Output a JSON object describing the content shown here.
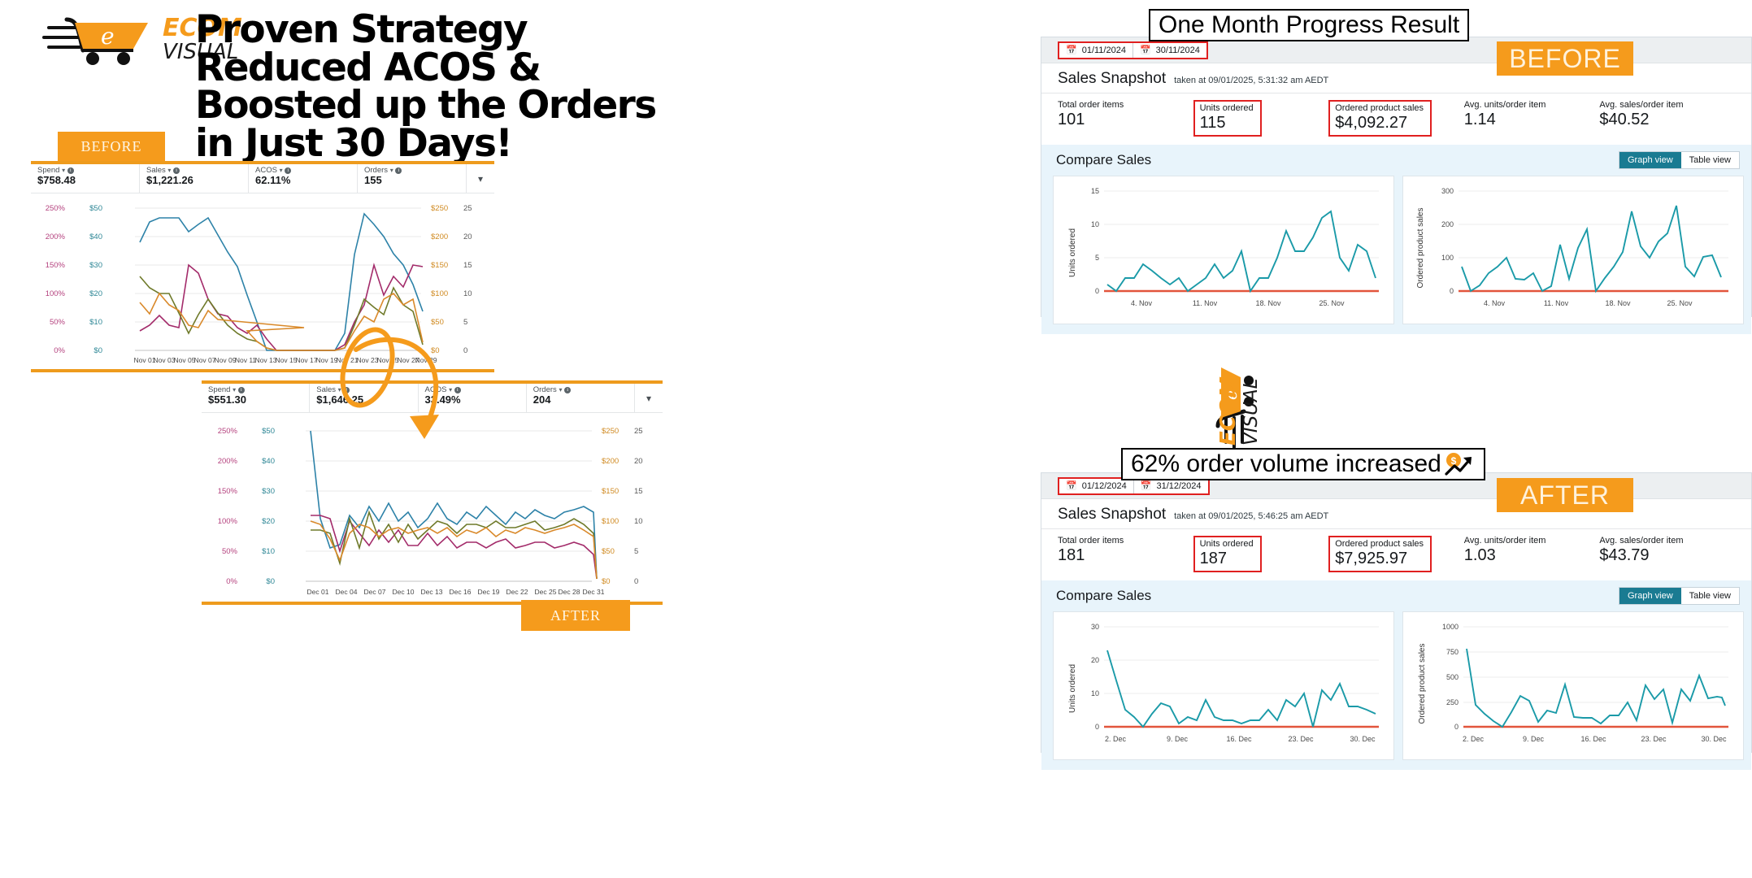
{
  "brand": {
    "ecom": "ECOM",
    "visual": "VISUAL"
  },
  "headline": "Proven Strategy Reduced ACOS & Boosted up the Orders in Just 30 Days!",
  "tabs": {
    "before": "BEFORE",
    "after": "AFTER"
  },
  "callouts": {
    "title1": "One Month Progress Result",
    "title2": "62% order volume increased",
    "badge_before": "BEFORE",
    "badge_after": "AFTER"
  },
  "colors": {
    "accent_orange": "#F59B1C",
    "highlight_red": "#e02020",
    "teal_line": "#1a9aa8",
    "panel_blue": "#e8f4fb",
    "toggle_active": "#1a7b92"
  },
  "ads_before": {
    "metrics": [
      {
        "label": "Spend",
        "value": "$758.48"
      },
      {
        "label": "Sales",
        "value": "$1,221.26"
      },
      {
        "label": "ACOS",
        "value": "62.11%"
      },
      {
        "label": "Orders",
        "value": "155"
      }
    ],
    "left_axis_pct": [
      "250%",
      "200%",
      "150%",
      "100%",
      "50%",
      "0%"
    ],
    "left_axis_usd": [
      "$50",
      "$40",
      "$30",
      "$20",
      "$10",
      "$0"
    ],
    "right_axis_usd": [
      "$250",
      "$200",
      "$150",
      "$100",
      "$50",
      "$0"
    ],
    "right_axis_count": [
      "25",
      "20",
      "15",
      "10",
      "5",
      "0"
    ],
    "x_ticks": [
      "Nov 01",
      "Nov 03",
      "Nov 05",
      "Nov 07",
      "Nov 09",
      "Nov 11",
      "Nov 13",
      "Nov 15",
      "Nov 17",
      "Nov 19",
      "Nov 21",
      "Nov 23",
      "Nov 25",
      "Nov 27",
      "Nov 29"
    ]
  },
  "ads_after": {
    "metrics": [
      {
        "label": "Spend",
        "value": "$551.30"
      },
      {
        "label": "Sales",
        "value": "$1,646.25"
      },
      {
        "label": "ACOS",
        "value": "33.49%"
      },
      {
        "label": "Orders",
        "value": "204"
      }
    ],
    "left_axis_pct": [
      "250%",
      "200%",
      "150%",
      "100%",
      "50%",
      "0%"
    ],
    "left_axis_usd": [
      "$50",
      "$40",
      "$30",
      "$20",
      "$10",
      "$0"
    ],
    "right_axis_usd": [
      "$250",
      "$200",
      "$150",
      "$100",
      "$50",
      "$0"
    ],
    "right_axis_count": [
      "25",
      "20",
      "15",
      "10",
      "5",
      "0"
    ],
    "x_ticks": [
      "Dec 01",
      "Dec 04",
      "Dec 07",
      "Dec 10",
      "Dec 13",
      "Dec 16",
      "Dec 19",
      "Dec 22",
      "Dec 25",
      "Dec 28",
      "Dec 31"
    ]
  },
  "snapshot_before": {
    "date_from": "01/11/2024",
    "date_to": "30/11/2024",
    "title": "Sales Snapshot",
    "subtitle": "taken at 09/01/2025, 5:31:32 am AEDT",
    "kpis": [
      {
        "label": "Total order items",
        "value": "101",
        "boxed": false
      },
      {
        "label": "Units ordered",
        "value": "115",
        "boxed": true
      },
      {
        "label": "Ordered product sales",
        "value": "$4,092.27",
        "boxed": true
      },
      {
        "label": "Avg. units/order item",
        "value": "1.14",
        "boxed": false
      },
      {
        "label": "Avg. sales/order item",
        "value": "$40.52",
        "boxed": false
      }
    ],
    "compare_title": "Compare Sales",
    "graph_view": "Graph view",
    "table_view": "Table view"
  },
  "snapshot_after": {
    "date_from": "01/12/2024",
    "date_to": "31/12/2024",
    "title": "Sales Snapshot",
    "subtitle": "taken at 09/01/2025, 5:46:25 am AEDT",
    "kpis": [
      {
        "label": "Total order items",
        "value": "181",
        "boxed": false
      },
      {
        "label": "Units ordered",
        "value": "187",
        "boxed": true
      },
      {
        "label": "Ordered product sales",
        "value": "$7,925.97",
        "boxed": true
      },
      {
        "label": "Avg. units/order item",
        "value": "1.03",
        "boxed": false
      },
      {
        "label": "Avg. sales/order item",
        "value": "$43.79",
        "boxed": false
      }
    ],
    "compare_title": "Compare Sales",
    "graph_view": "Graph view",
    "table_view": "Table view"
  },
  "chart_data": [
    {
      "id": "before_units_ordered",
      "type": "line",
      "title": "",
      "ylabel": "Units ordered",
      "xlabel": "",
      "ylim": [
        0,
        15
      ],
      "yticks": [
        0,
        5,
        10,
        15
      ],
      "xticks": [
        "4. Nov",
        "11. Nov",
        "18. Nov",
        "25. Nov"
      ],
      "x": [
        "1. Nov",
        "2. Nov",
        "3. Nov",
        "4. Nov",
        "5. Nov",
        "6. Nov",
        "7. Nov",
        "8. Nov",
        "9. Nov",
        "10. Nov",
        "11. Nov",
        "12. Nov",
        "13. Nov",
        "14. Nov",
        "15. Nov",
        "16. Nov",
        "17. Nov",
        "18. Nov",
        "19. Nov",
        "20. Nov",
        "21. Nov",
        "22. Nov",
        "23. Nov",
        "24. Nov",
        "25. Nov",
        "26. Nov",
        "27. Nov",
        "28. Nov",
        "29. Nov",
        "30. Nov"
      ],
      "values": [
        1,
        0,
        2,
        2,
        4,
        3,
        2,
        1,
        2,
        0,
        1,
        2,
        4,
        2,
        3,
        6,
        0,
        2,
        2,
        5,
        9,
        6,
        6,
        8,
        11,
        12,
        5,
        3,
        7,
        6,
        2
      ],
      "grid": true,
      "legend": "none"
    },
    {
      "id": "before_ordered_product_sales",
      "type": "line",
      "title": "",
      "ylabel": "Ordered product sales",
      "xlabel": "",
      "ylim": [
        0,
        300
      ],
      "yticks": [
        0,
        100,
        200,
        300
      ],
      "xticks": [
        "4. Nov",
        "11. Nov",
        "18. Nov",
        "25. Nov"
      ],
      "x": [
        "1. Nov",
        "2. Nov",
        "3. Nov",
        "4. Nov",
        "5. Nov",
        "6. Nov",
        "7. Nov",
        "8. Nov",
        "9. Nov",
        "10. Nov",
        "11. Nov",
        "12. Nov",
        "13. Nov",
        "14. Nov",
        "15. Nov",
        "16. Nov",
        "17. Nov",
        "18. Nov",
        "19. Nov",
        "20. Nov",
        "21. Nov",
        "22. Nov",
        "23. Nov",
        "24. Nov",
        "25. Nov",
        "26. Nov",
        "27. Nov",
        "28. Nov",
        "29. Nov",
        "30. Nov"
      ],
      "values": [
        72,
        0,
        18,
        53,
        72,
        100,
        36,
        34,
        54,
        0,
        15,
        140,
        37,
        130,
        185,
        0,
        40,
        72,
        118,
        240,
        133,
        100,
        148,
        172,
        257,
        72,
        43,
        103,
        107,
        42
      ],
      "grid": true,
      "legend": "none"
    },
    {
      "id": "after_units_ordered",
      "type": "line",
      "title": "",
      "ylabel": "Units ordered",
      "xlabel": "",
      "ylim": [
        0,
        30
      ],
      "yticks": [
        0,
        10,
        20,
        30
      ],
      "xticks": [
        "2. Dec",
        "9. Dec",
        "16. Dec",
        "23. Dec",
        "30. Dec"
      ],
      "x": [
        "1. Dec",
        "2. Dec",
        "3. Dec",
        "4. Dec",
        "5. Dec",
        "6. Dec",
        "7. Dec",
        "8. Dec",
        "9. Dec",
        "10. Dec",
        "11. Dec",
        "12. Dec",
        "13. Dec",
        "14. Dec",
        "15. Dec",
        "16. Dec",
        "17. Dec",
        "18. Dec",
        "19. Dec",
        "20. Dec",
        "21. Dec",
        "22. Dec",
        "23. Dec",
        "24. Dec",
        "25. Dec",
        "26. Dec",
        "27. Dec",
        "28. Dec",
        "29. Dec",
        "30. Dec",
        "31. Dec"
      ],
      "values": [
        23,
        14,
        5,
        3,
        0,
        4,
        7,
        6,
        1,
        3,
        2,
        8,
        3,
        2,
        2,
        1,
        2,
        2,
        5,
        2,
        8,
        6,
        10,
        0,
        11,
        8,
        13,
        6,
        6,
        5,
        4
      ],
      "grid": true,
      "legend": "none"
    },
    {
      "id": "after_ordered_product_sales",
      "type": "line",
      "title": "",
      "ylabel": "Ordered product sales",
      "xlabel": "",
      "ylim": [
        0,
        1000
      ],
      "yticks": [
        0,
        250,
        500,
        750,
        1000
      ],
      "xticks": [
        "2. Dec",
        "9. Dec",
        "16. Dec",
        "23. Dec",
        "30. Dec"
      ],
      "x": [
        "1. Dec",
        "2. Dec",
        "3. Dec",
        "4. Dec",
        "5. Dec",
        "6. Dec",
        "7. Dec",
        "8. Dec",
        "9. Dec",
        "10. Dec",
        "11. Dec",
        "12. Dec",
        "13. Dec",
        "14. Dec",
        "15. Dec",
        "16. Dec",
        "17. Dec",
        "18. Dec",
        "19. Dec",
        "20. Dec",
        "21. Dec",
        "22. Dec",
        "23. Dec",
        "24. Dec",
        "25. Dec",
        "26. Dec",
        "27. Dec",
        "28. Dec",
        "29. Dec",
        "30. Dec",
        "31. Dec"
      ],
      "values": [
        780,
        220,
        130,
        60,
        0,
        150,
        310,
        260,
        50,
        165,
        140,
        420,
        95,
        90,
        90,
        30,
        110,
        110,
        245,
        65,
        415,
        280,
        375,
        40,
        370,
        260,
        510,
        285,
        300,
        290,
        215
      ],
      "grid": true,
      "legend": "none"
    },
    {
      "id": "ads_before_multiline",
      "type": "line",
      "title": "",
      "ylabel": "Spend / Sales / ACOS / Orders",
      "xlabel": "",
      "ylim": [
        0,
        50
      ],
      "xticks": [
        "Nov 01",
        "Nov 03",
        "Nov 05",
        "Nov 07",
        "Nov 09",
        "Nov 11",
        "Nov 13",
        "Nov 15",
        "Nov 17",
        "Nov 19",
        "Nov 21",
        "Nov 23",
        "Nov 25",
        "Nov 27",
        "Nov 29"
      ],
      "series": [
        {
          "name": "Sales",
          "color": "#2d82a8",
          "values": [
            35,
            40,
            42,
            42,
            42,
            38,
            40,
            42,
            36,
            30,
            25,
            12,
            5,
            0,
            0,
            0,
            0,
            0,
            0,
            0,
            0,
            6,
            34,
            48,
            45,
            40,
            34,
            30,
            24,
            14
          ]
        },
        {
          "name": "ACOS",
          "color": "#a32b6a",
          "values": [
            7,
            9,
            12,
            9,
            8,
            30,
            27,
            18,
            13,
            12,
            8,
            6,
            9,
            4,
            0,
            0,
            0,
            0,
            0,
            0,
            0,
            2,
            10,
            16,
            30,
            19,
            26,
            22,
            30,
            29
          ]
        },
        {
          "name": "Spend",
          "color": "#8a8a2a",
          "values": [
            26,
            22,
            20,
            20,
            13,
            6,
            12,
            18,
            13,
            9,
            6,
            4,
            3,
            1,
            0,
            0,
            0,
            0,
            0,
            0,
            0,
            1,
            9,
            18,
            14,
            12,
            22,
            16,
            14,
            2
          ]
        },
        {
          "name": "Orders",
          "color": "#d9892a",
          "values": [
            17,
            13,
            20,
            16,
            14,
            9,
            8,
            14,
            11,
            8,
            7,
            5,
            3,
            1,
            0,
            0,
            0,
            0,
            0,
            0,
            0,
            1,
            7,
            12,
            10,
            18,
            20,
            16,
            18,
            3
          ]
        }
      ],
      "grid": true,
      "legend": "none"
    },
    {
      "id": "ads_after_multiline",
      "type": "line",
      "title": "",
      "ylabel": "Spend / Sales / ACOS / Orders",
      "xlabel": "",
      "ylim": [
        0,
        50
      ],
      "xticks": [
        "Dec 01",
        "Dec 04",
        "Dec 07",
        "Dec 10",
        "Dec 13",
        "Dec 16",
        "Dec 19",
        "Dec 22",
        "Dec 25",
        "Dec 28",
        "Dec 31"
      ],
      "series": [
        {
          "name": "Sales",
          "color": "#2d82a8",
          "values": [
            50,
            29,
            15,
            16,
            22,
            18,
            25,
            20,
            26,
            20,
            23,
            18,
            21,
            25,
            21,
            19,
            22,
            20,
            24,
            21,
            19,
            22,
            20,
            23,
            21,
            20,
            22,
            23,
            24,
            22,
            1
          ]
        },
        {
          "name": "ACOS",
          "color": "#a32b6a",
          "values": [
            22,
            22,
            21,
            9,
            20,
            16,
            12,
            17,
            13,
            17,
            12,
            12,
            16,
            12,
            15,
            11,
            13,
            13,
            11,
            13,
            14,
            11,
            12,
            13,
            13,
            11,
            12,
            13,
            12,
            9,
            1
          ]
        },
        {
          "name": "Spend",
          "color": "#6f7a2a",
          "values": [
            17,
            17,
            16,
            5,
            21,
            11,
            23,
            14,
            19,
            13,
            19,
            14,
            17,
            20,
            19,
            16,
            19,
            19,
            18,
            20,
            18,
            18,
            19,
            20,
            17,
            18,
            19,
            21,
            19,
            16,
            1
          ]
        },
        {
          "name": "Orders",
          "color": "#d9892a",
          "values": [
            20,
            19,
            14,
            6,
            16,
            19,
            18,
            15,
            17,
            18,
            16,
            17,
            18,
            16,
            18,
            15,
            17,
            16,
            18,
            15,
            17,
            16,
            18,
            17,
            16,
            17,
            18,
            19,
            17,
            15,
            1
          ]
        }
      ],
      "grid": true,
      "legend": "none"
    }
  ]
}
